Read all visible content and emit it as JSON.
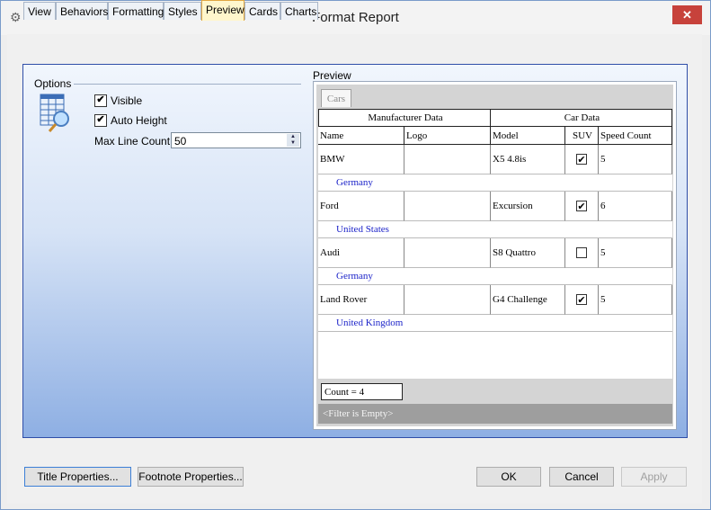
{
  "window": {
    "title": "Format Report",
    "close_glyph": "✕",
    "app_icon": "gear-icon"
  },
  "tabs": [
    {
      "label": "View"
    },
    {
      "label": "Behaviors"
    },
    {
      "label": "Formatting"
    },
    {
      "label": "Styles"
    },
    {
      "label": "Preview",
      "active": true
    },
    {
      "label": "Cards"
    },
    {
      "label": "Charts"
    }
  ],
  "options": {
    "group_label": "Options",
    "visible_label": "Visible",
    "visible_checked": true,
    "auto_height_label": "Auto Height",
    "auto_height_checked": true,
    "max_line_count_label": "Max Line Count:",
    "max_line_count_value": "50"
  },
  "preview": {
    "label": "Preview",
    "grid_tab": "Cars",
    "band_headers": [
      "Manufacturer Data",
      "Car Data"
    ],
    "columns": [
      "Name",
      "Logo",
      "Model",
      "SUV",
      "Speed Count"
    ],
    "rows": [
      {
        "name": "BMW",
        "logo": "",
        "model": "X5 4.8is",
        "suv": true,
        "speed_count": "5",
        "country": "Germany"
      },
      {
        "name": "Ford",
        "logo": "",
        "model": "Excursion",
        "suv": true,
        "speed_count": "6",
        "country": "United States"
      },
      {
        "name": "Audi",
        "logo": "",
        "model": "S8 Quattro",
        "suv": false,
        "speed_count": "5",
        "country": "Germany"
      },
      {
        "name": "Land Rover",
        "logo": "",
        "model": "G4 Challenge",
        "suv": true,
        "speed_count": "5",
        "country": "United Kingdom"
      }
    ],
    "count_text": "Count = 4",
    "filter_text": "<Filter is Empty>"
  },
  "buttons": {
    "title_properties": "Title Properties...",
    "footnote_properties": "Footnote Properties...",
    "ok": "OK",
    "cancel": "Cancel",
    "apply": "Apply"
  },
  "colors": {
    "accent": "#2f4ea8",
    "country_text": "#1d24c9",
    "active_tab": "#fff6cc",
    "close_button": "#c7423b"
  }
}
